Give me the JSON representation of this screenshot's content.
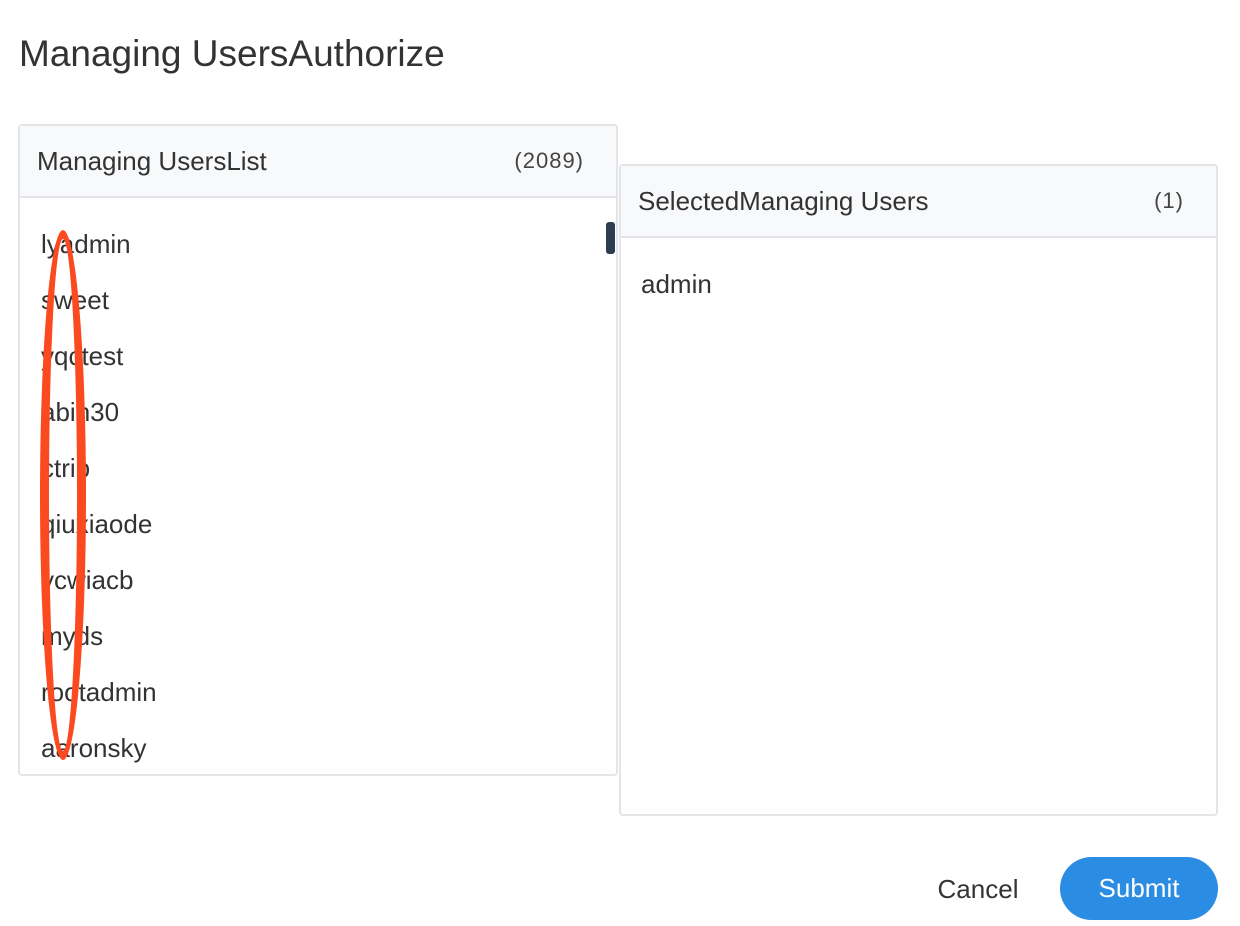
{
  "dialog": {
    "title": "Managing UsersAuthorize"
  },
  "source_panel": {
    "title": "Managing UsersList",
    "count": "(2089)",
    "items": [
      "lyadmin",
      "sweet",
      "yqctest",
      "abin30",
      "ctrip",
      "qiuxiaode",
      "ycwiacb",
      "myds",
      "rootadmin",
      "aaronsky"
    ]
  },
  "target_panel": {
    "title": "SelectedManaging Users",
    "count": "(1)",
    "items": [
      "admin"
    ]
  },
  "actions": {
    "cancel_label": "Cancel",
    "submit_label": "Submit"
  },
  "colors": {
    "primary": "#2b8ce4",
    "annotation": "#fb4a1f",
    "scroll_thumb": "#2c3e50",
    "panel_border": "#e3e5e8",
    "panel_header_bg": "#f8f9fb"
  }
}
